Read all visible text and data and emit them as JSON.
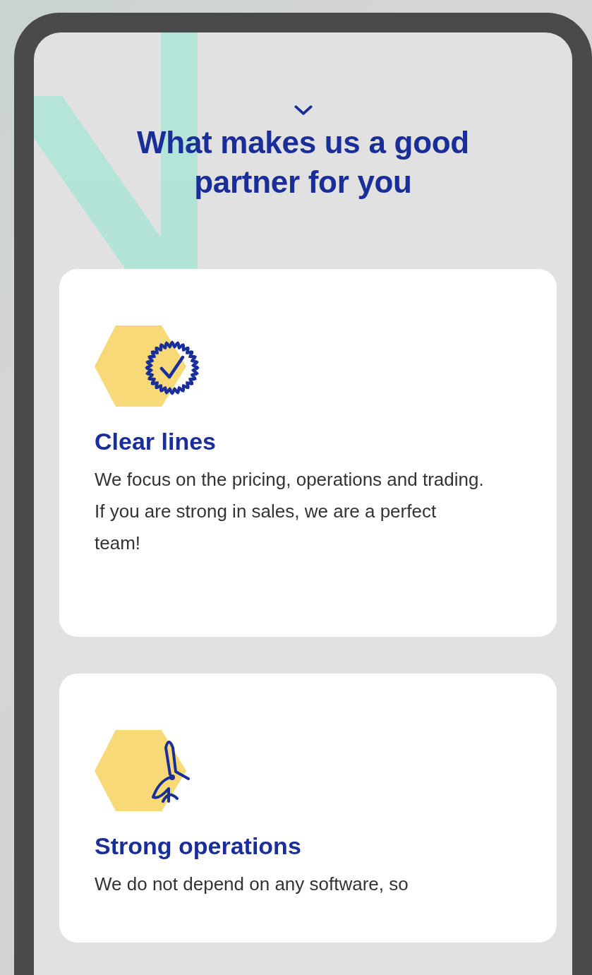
{
  "heading": "What makes us a good partner for you",
  "features": [
    {
      "kind": "badge",
      "title": "Clear lines",
      "text": "We focus on the pricing, operations and trading. If you are strong in sales, we are a perfect team!"
    },
    {
      "kind": "turbine",
      "title": "Strong operations",
      "text": "We do not depend on any software, so"
    }
  ]
}
